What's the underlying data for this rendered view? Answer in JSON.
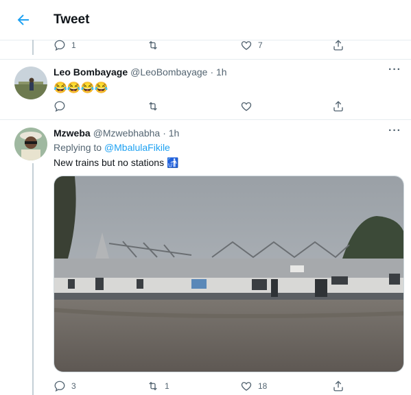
{
  "header": {
    "title": "Tweet",
    "back_icon": "back-arrow-icon"
  },
  "top_actions": {
    "reply_count": "1",
    "retweet_count": "",
    "like_count": "7"
  },
  "tweets": [
    {
      "name": "Leo Bombayage",
      "handle": "@LeoBombayage",
      "time": "· 1h",
      "text": "😂😂😂😂",
      "reply_count": "",
      "retweet_count": "",
      "like_count": ""
    },
    {
      "name": "Mzweba",
      "handle": "@Mzwebhabha",
      "time": "· 1h",
      "replying_prefix": "Replying to ",
      "replying_mention": "@MbalulaFikile",
      "text": "New trains but no stations 🚮",
      "reply_count": "3",
      "retweet_count": "1",
      "like_count": "18"
    }
  ],
  "colors": {
    "accent": "#1da1f2",
    "muted": "#536471",
    "divider": "#e6ecf0"
  }
}
